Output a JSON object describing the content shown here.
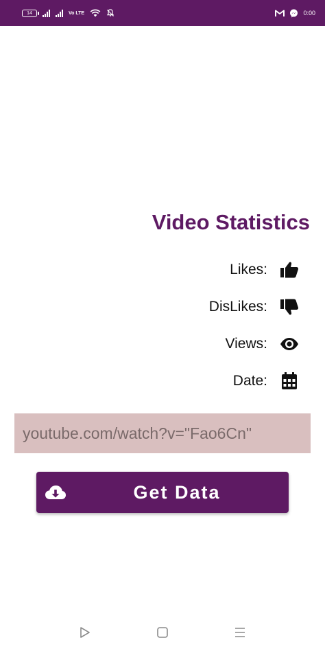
{
  "status_bar": {
    "battery": "14",
    "network_label": "Vo LTE",
    "notifications": [
      "gmail-icon",
      "messenger-icon"
    ],
    "time": "0:00",
    "background": "#5e1a63"
  },
  "stats": {
    "title": "Video Statistics",
    "likes_label": "Likes:",
    "dislikes_label": "DisLikes:",
    "views_label": "Views:",
    "date_label": "Date:",
    "icons": [
      "thumbs-up-icon",
      "thumbs-down-icon",
      "eye-icon",
      "calendar-icon"
    ]
  },
  "url_input": {
    "placeholder": "youtube.com/watch?v=\"Fao6Cn\"",
    "value": ""
  },
  "get_data_button": {
    "label": "Get Data",
    "icon": "cloud-download-icon"
  },
  "nav_bar": {
    "icons": [
      "back-icon",
      "home-icon",
      "menu-icon"
    ]
  },
  "colors": {
    "accent": "#5e1a63",
    "input_background": "#d9bfbf"
  }
}
